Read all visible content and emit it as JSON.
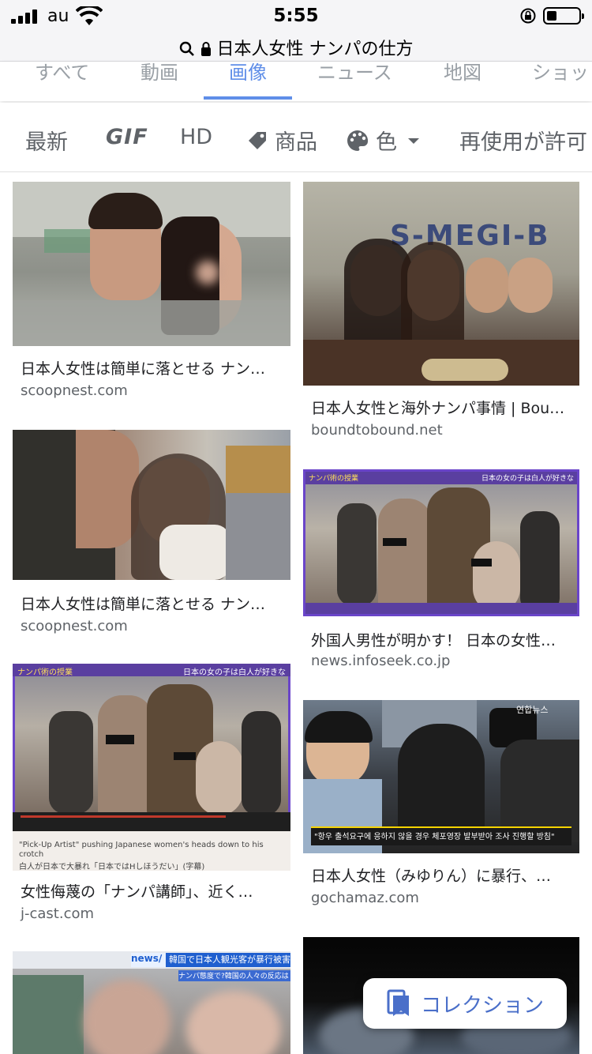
{
  "status_bar": {
    "carrier": "au",
    "time": "5:55"
  },
  "url_bar": {
    "query": "日本人女性 ナンパの仕方"
  },
  "tabs": [
    {
      "label": "すべて",
      "active": false
    },
    {
      "label": "動画",
      "active": false
    },
    {
      "label": "画像",
      "active": true
    },
    {
      "label": "ニュース",
      "active": false
    },
    {
      "label": "地図",
      "active": false
    },
    {
      "label": "ショッ",
      "active": false
    }
  ],
  "filters": {
    "latest": "最新",
    "gif": "GIF",
    "hd": "HD",
    "products": "商品",
    "color": "色",
    "reuse": "再使用が許可"
  },
  "results": [
    {
      "title": "日本人女性は簡単に落とせる ナン…",
      "source": "scoopnest.com"
    },
    {
      "title": "日本人女性と海外ナンパ事情 | Bou…",
      "source": "boundtobound.net"
    },
    {
      "title": "日本人女性は簡単に落とせる ナン…",
      "source": "scoopnest.com"
    },
    {
      "title": "外国人男性が明かす！ 日本の女性…",
      "source": "news.infoseek.co.jp"
    },
    {
      "title": "女性侮蔑の「ナンパ講師」、近く…",
      "source": "j-cast.com"
    },
    {
      "title": "日本人女性（みゆりん）に暴行、…",
      "source": "gochamaz.com"
    }
  ],
  "image_text": {
    "card2_sign": "S-MEGI-B",
    "card5_caption_en": "\"Pick-Up Artist\" pushing Japanese women's heads down to his crotch",
    "card5_caption_jp": "白人が日本で大暴れ「日本ではHしほうだい」(字幕)",
    "card5_banner_left": "ナンパ術の授業",
    "card5_banner_right": "日本の女の子は白人が好きな",
    "card4_banner_left": "ナンパ術の授業",
    "card4_banner_right": "日本の女の子は白人が好きな",
    "card6_caption": "\"항우 출석요구에 응하지 않을 경우 체포영장 발부받아 조사 진행할 방침\"",
    "card6_logo": "연합뉴스",
    "card7_logo": "news/",
    "card7_headline": "韓国で日本人観光客が暴行被害",
    "card7_sub": "ナンパ態度で?韓国の人々の反応は"
  },
  "collection_button": "コレクション",
  "colors": {
    "accent": "#5f8ee8",
    "text": "#202124",
    "muted": "#5f6368"
  }
}
